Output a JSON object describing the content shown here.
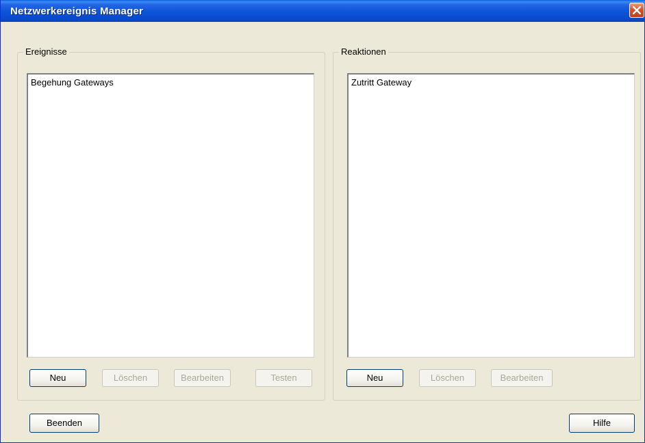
{
  "window": {
    "title": "Netzwerkereignis Manager"
  },
  "events": {
    "legend": "Ereignisse",
    "items": [
      "Begehung Gateways"
    ],
    "buttons": {
      "new": "Neu",
      "delete": "Löschen",
      "edit": "Bearbeiten",
      "test": "Testen"
    }
  },
  "reactions": {
    "legend": "Reaktionen",
    "items": [
      "Zutritt Gateway"
    ],
    "buttons": {
      "new": "Neu",
      "delete": "Löschen",
      "edit": "Bearbeiten"
    }
  },
  "footer": {
    "exit": "Beenden",
    "help": "Hilfe"
  },
  "icons": {
    "close": "close-icon"
  },
  "colors": {
    "titlebar": "#0A4BCF",
    "dialog_bg": "#ECE9D8",
    "close_button": "#D9522B"
  }
}
